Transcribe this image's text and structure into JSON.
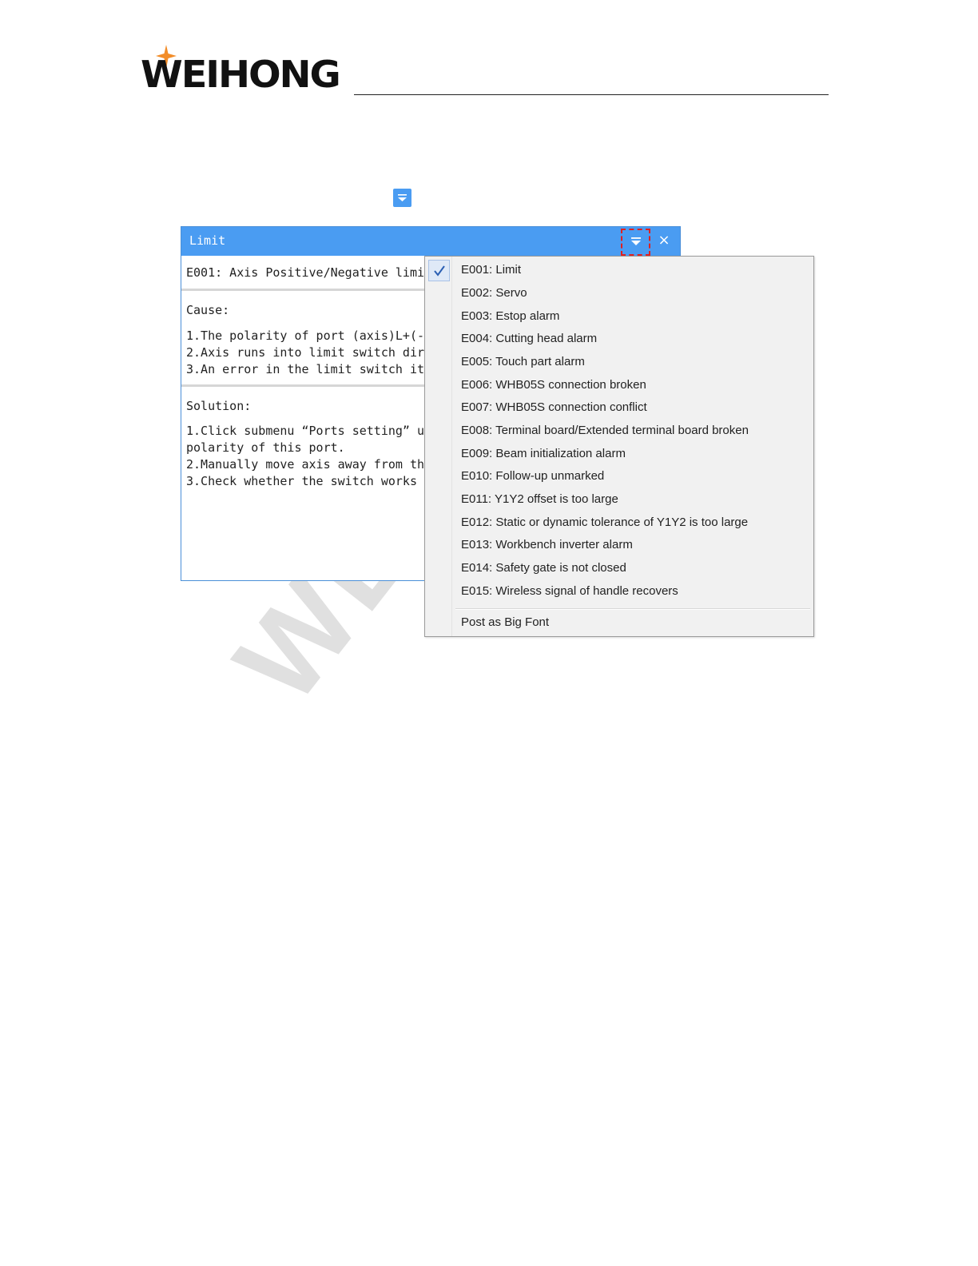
{
  "brand": {
    "logo_text": "WEIHONG",
    "accent_color": "#f28c28"
  },
  "watermark": {
    "text": "WEIH"
  },
  "dialog": {
    "title": "Limit",
    "menu_icon": "dropdown-menu-icon",
    "close_label": "×",
    "alarm_line": "E001: Axis Positive/Negative limi",
    "cause": {
      "heading": "Cause:",
      "lines": [
        "1.The polarity of port (axis)L+(-",
        "2.Axis runs into limit switch dir",
        "3.An error in the limit switch it"
      ]
    },
    "solution": {
      "heading": "Solution:",
      "lines": [
        "1.Click submenu “Ports setting” u",
        "polarity of this port.",
        "2.Manually move axis away from th",
        "3.Check whether the switch works"
      ]
    },
    "title_color": "#4a9cf2"
  },
  "menu": {
    "checked_index": 0,
    "items": [
      "E001: Limit",
      "E002: Servo",
      "E003: Estop alarm",
      "E004: Cutting head alarm",
      "E005: Touch part alarm",
      "E006: WHB05S connection broken",
      "E007: WHB05S connection conflict",
      "E008: Terminal board/Extended terminal board broken",
      "E009: Beam initialization alarm",
      "E010: Follow-up unmarked",
      "E011: Y1Y2 offset is too large",
      "E012: Static or dynamic tolerance of Y1Y2 is too large",
      "E013: Workbench inverter alarm",
      "E014: Safety gate is not closed",
      "E015: Wireless signal of handle recovers"
    ],
    "footer_item": "Post as Big Font"
  }
}
